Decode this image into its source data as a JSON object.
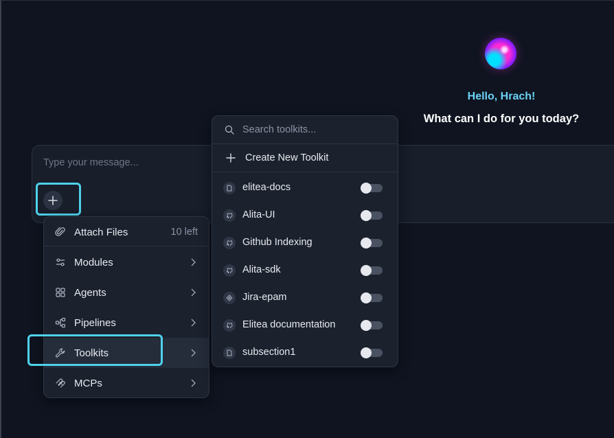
{
  "greeting": {
    "hello": "Hello, Hrach!",
    "question": "What can I do for you today?"
  },
  "composer": {
    "placeholder": "Type your message..."
  },
  "add_menu": {
    "items": [
      {
        "label": "Attach Files",
        "meta": "10 left",
        "icon": "paperclip-icon"
      },
      {
        "label": "Modules",
        "icon": "sliders-icon"
      },
      {
        "label": "Agents",
        "icon": "grid-icon"
      },
      {
        "label": "Pipelines",
        "icon": "flow-icon"
      },
      {
        "label": "Toolkits",
        "icon": "wrench-icon"
      },
      {
        "label": "MCPs",
        "icon": "mcp-icon"
      }
    ]
  },
  "toolkit_panel": {
    "search_placeholder": "Search toolkits...",
    "create_label": "Create New Toolkit",
    "toolkits": [
      {
        "label": "elitea-docs",
        "icon": "doc-icon",
        "enabled": false
      },
      {
        "label": "Alita-UI",
        "icon": "github-icon",
        "enabled": false
      },
      {
        "label": "Github Indexing",
        "icon": "github-icon",
        "enabled": false
      },
      {
        "label": "Alita-sdk",
        "icon": "github-icon",
        "enabled": false
      },
      {
        "label": "Jira-epam",
        "icon": "jira-icon",
        "enabled": false
      },
      {
        "label": "Elitea documentation",
        "icon": "github-icon",
        "enabled": false
      },
      {
        "label": "subsection1",
        "icon": "doc-icon",
        "enabled": false
      }
    ]
  },
  "colors": {
    "accent": "#4fd2ea",
    "hello_text": "#6bd2f5",
    "background": "#0f1420",
    "surface": "#1b212d"
  }
}
